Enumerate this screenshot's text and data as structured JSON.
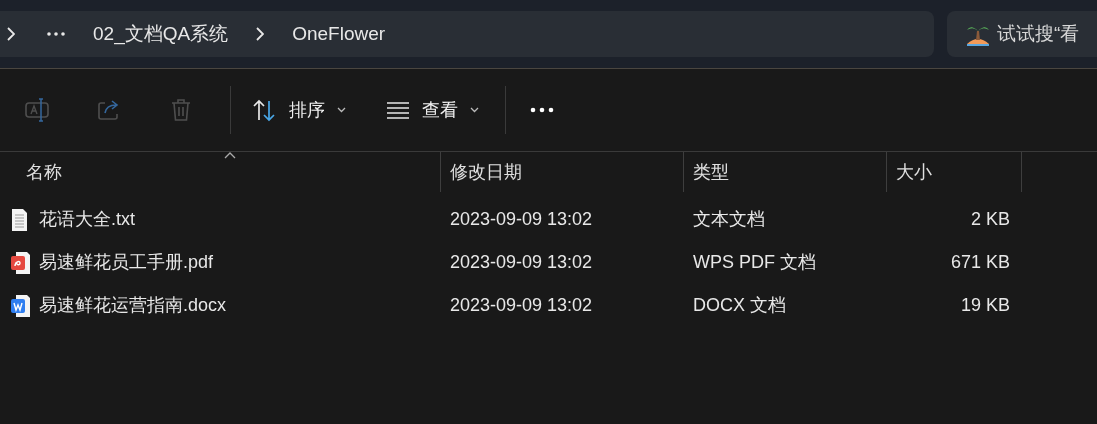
{
  "address_bar": {
    "crumbs": [
      "02_文档QA系统",
      "OneFlower"
    ]
  },
  "search": {
    "placeholder": "试试搜“看"
  },
  "toolbar": {
    "icon_buttons": [
      {
        "kind": "rename",
        "disabled": true
      },
      {
        "kind": "share",
        "disabled": true
      },
      {
        "kind": "delete",
        "disabled": true
      }
    ],
    "menus": [
      {
        "kind": "sort",
        "label": "排序"
      },
      {
        "kind": "view",
        "label": "查看"
      }
    ]
  },
  "table": {
    "columns": [
      {
        "label": "名称",
        "sorted": true
      },
      {
        "label": "修改日期",
        "sorted": false
      },
      {
        "label": "类型",
        "sorted": false
      },
      {
        "label": "大小",
        "sorted": false
      }
    ],
    "rows": [
      {
        "kind": "txt",
        "name": "花语大全.txt",
        "modified": "2023-09-09 13:02",
        "type": "文本文档",
        "size": "2 KB"
      },
      {
        "kind": "pdf",
        "name": "易速鲜花员工手册.pdf",
        "modified": "2023-09-09 13:02",
        "type": "WPS PDF 文档",
        "size": "671 KB"
      },
      {
        "kind": "docx",
        "name": "易速鲜花运营指南.docx",
        "modified": "2023-09-09 13:02",
        "type": "DOCX 文档",
        "size": "19 KB"
      }
    ]
  }
}
